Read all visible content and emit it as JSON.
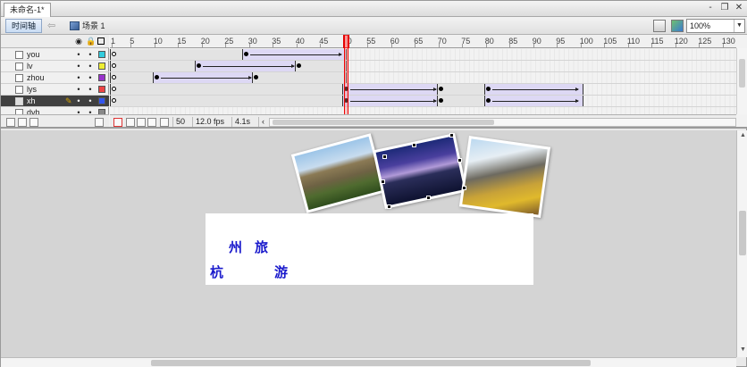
{
  "document": {
    "tab_title": "未命名-1*"
  },
  "window_controls": {
    "minimize": "-",
    "restore": "❐",
    "close": "✕"
  },
  "toolbar": {
    "timeline_button": "时间轴",
    "back_glyph": "⇦",
    "scene_label": "场景 1",
    "zoom_value": "100%"
  },
  "timeline": {
    "header_icons": {
      "eye": "👁",
      "lock": "🔒",
      "outline": "□"
    },
    "ruler": [
      "1",
      "5",
      "10",
      "15",
      "20",
      "25",
      "30",
      "35",
      "40",
      "45",
      "50",
      "55",
      "60",
      "65",
      "70",
      "75",
      "80",
      "85",
      "90",
      "95",
      "100",
      "105",
      "110",
      "115",
      "120",
      "125",
      "130"
    ],
    "layers": [
      {
        "name": "you",
        "color": "#33ccdd",
        "selected": false
      },
      {
        "name": "lv",
        "color": "#eeee33",
        "selected": false
      },
      {
        "name": "zhou",
        "color": "#9933cc",
        "selected": false
      },
      {
        "name": "lys",
        "color": "#ee4444",
        "selected": false
      },
      {
        "name": "xh",
        "color": "#3355ee",
        "selected": true
      },
      {
        "name": "dyh",
        "color": "#888888",
        "selected": false
      }
    ],
    "status": {
      "current_frame": "50",
      "frame_rate": "12.0 fps",
      "elapsed": "4.1s"
    }
  },
  "stage": {
    "characters": [
      "州",
      "旅",
      "杭",
      "游"
    ]
  }
}
